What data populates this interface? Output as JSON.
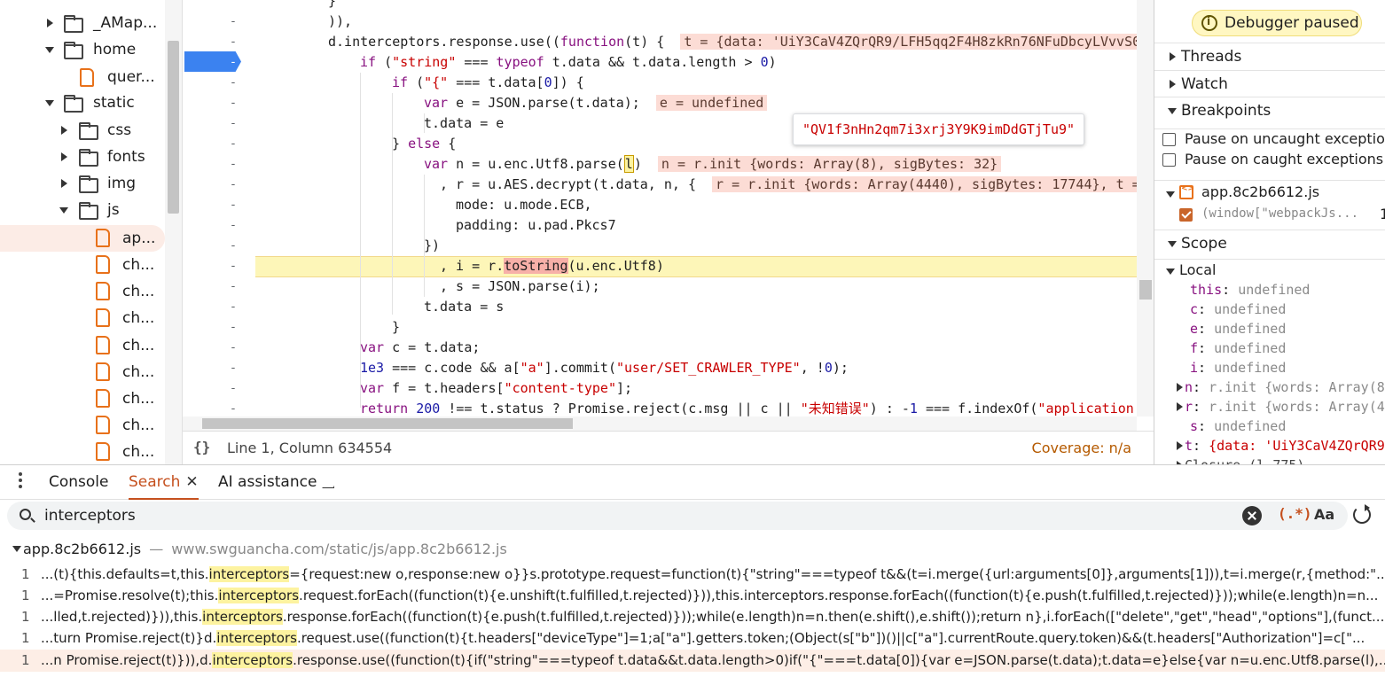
{
  "file_tree": {
    "items": [
      {
        "label": "_AMap...",
        "type": "folder",
        "expanded": false
      },
      {
        "label": "home",
        "type": "folder",
        "expanded": true
      },
      {
        "label": "quer...",
        "type": "file"
      },
      {
        "label": "static",
        "type": "folder",
        "expanded": true
      },
      {
        "label": "css",
        "type": "folder",
        "expanded": false
      },
      {
        "label": "fonts",
        "type": "folder",
        "expanded": false
      },
      {
        "label": "img",
        "type": "folder",
        "expanded": false
      },
      {
        "label": "js",
        "type": "folder",
        "expanded": true
      },
      {
        "label": "ap...",
        "type": "file",
        "selected": true
      },
      {
        "label": "ch...",
        "type": "file"
      },
      {
        "label": "ch...",
        "type": "file"
      },
      {
        "label": "ch...",
        "type": "file"
      },
      {
        "label": "ch...",
        "type": "file"
      },
      {
        "label": "ch...",
        "type": "file"
      },
      {
        "label": "ch...",
        "type": "file"
      },
      {
        "label": "ch...",
        "type": "file"
      },
      {
        "label": "ch...",
        "type": "file"
      }
    ]
  },
  "editor": {
    "gutter_mark": "-",
    "tooltip": "\"QV1f3nHn2qm7i3xrj3Y9K9imDdGTjTu9\"",
    "inline_values": {
      "t": "t = {data: 'UiY3CaV4ZQrQR9/LFH5qq2F4H8zkRn76NFuDbcyLVvvS0",
      "e": "e = undefined",
      "n": "n = r.init {words: Array(8), sigBytes: 32}",
      "r": "r = r.init {words: Array(4440), sigBytes: 17744}, t ="
    },
    "status": {
      "braces": "{}",
      "position": "Line 1, Column 634554",
      "coverage": "Coverage: n/a"
    }
  },
  "sidebar": {
    "paused_label": "Debugger paused",
    "sections": {
      "threads": "Threads",
      "watch": "Watch",
      "breakpoints": "Breakpoints",
      "scope": "Scope"
    },
    "pause_uncaught": "Pause on uncaught exceptions",
    "pause_caught": "Pause on caught exceptions",
    "bp_file": "app.8c2b6612.js",
    "bp_code": "(window[\"webpackJs...",
    "bp_line": "1",
    "scope_local": "Local",
    "scope_vars": [
      {
        "name": "this",
        "value": "undefined",
        "expandable": false
      },
      {
        "name": "c",
        "value": "undefined",
        "expandable": false
      },
      {
        "name": "e",
        "value": "undefined",
        "expandable": false
      },
      {
        "name": "f",
        "value": "undefined",
        "expandable": false
      },
      {
        "name": "i",
        "value": "undefined",
        "expandable": false
      },
      {
        "name": "n",
        "value": "r.init {words: Array(8",
        "expandable": true
      },
      {
        "name": "r",
        "value": "r.init {words: Array(4",
        "expandable": true
      },
      {
        "name": "s",
        "value": "undefined",
        "expandable": false
      },
      {
        "name": "t",
        "value": "{data: 'UiY3CaV4ZQrQR9",
        "expandable": true,
        "is_string": true
      }
    ],
    "closure_label": "Closure (l.775)"
  },
  "drawer": {
    "tabs": {
      "console": "Console",
      "search": "Search",
      "close": "✕",
      "ai": "AI assistance"
    },
    "search": {
      "query": "interceptors",
      "placeholder": "Search",
      "regex_label": "(.*)",
      "case_label": "Aa"
    },
    "results": {
      "file_name": "app.8c2b6612.js",
      "file_sep": "—",
      "file_url": "www.swguancha.com/static/js/app.8c2b6612.js",
      "rows": [
        {
          "line": "1",
          "pre": "...(t){this.defaults=t,this.",
          "match": "interceptors",
          "post": "={request:new o,response:new o}}s.prototype.request=function(t){\"string\"===typeof t&&(t=i.merge({url:arguments[0]},arguments[1])),t=i.merge(r,{method:\"..."
        },
        {
          "line": "1",
          "pre": "...=Promise.resolve(t);this.",
          "match": "interceptors",
          "post": ".request.forEach((function(t){e.unshift(t.fulfilled,t.rejected)})),this.interceptors.response.forEach((function(t){e.push(t.fulfilled,t.rejected)}));while(e.length)n=n..."
        },
        {
          "line": "1",
          "pre": "...lled,t.rejected)})),this.",
          "match": "interceptors",
          "post": ".response.forEach((function(t){e.push(t.fulfilled,t.rejected)}));while(e.length)n=n.then(e.shift(),e.shift());return n},i.forEach([\"delete\",\"get\",\"head\",\"options\"],(funct..."
        },
        {
          "line": "1",
          "pre": "...turn Promise.reject(t)}d.",
          "match": "interceptors",
          "post": ".request.use((function(t){t.headers[\"deviceType\"]=1;a[\"a\"].getters.token;(Object(s[\"b\"])()||c[\"a\"].currentRoute.query.token)&&(t.headers[\"Authorization\"]=c[\"..."
        },
        {
          "line": "1",
          "pre": "...n Promise.reject(t)})),d.",
          "match": "interceptors",
          "post": ".response.use((function(t){if(\"string\"===typeof t.data&&t.data.length>0)if(\"{\"===t.data[0]){var e=JSON.parse(t.data);t.data=e}else{var n=u.enc.Utf8.parse(l),...",
          "selected": true
        }
      ]
    }
  }
}
